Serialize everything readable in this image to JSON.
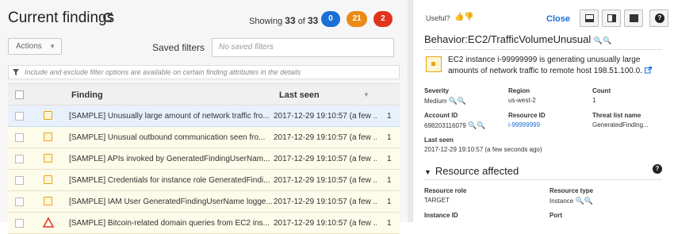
{
  "header": {
    "title": "Current findings",
    "showing_prefix": "Showing",
    "showing_count": "33",
    "showing_of": "of",
    "showing_total": "33",
    "badges": [
      {
        "value": "0",
        "color": "#1a6fd6"
      },
      {
        "value": "21",
        "color": "#ec8a16"
      },
      {
        "value": "2",
        "color": "#e0341b"
      }
    ]
  },
  "toolbar": {
    "actions_label": "Actions",
    "saved_filters_label": "Saved filters",
    "saved_filters_placeholder": "No saved filters"
  },
  "filter_bar": {
    "text": "Include and exclude filter options are available on certain finding attributes in the details"
  },
  "table": {
    "columns": {
      "finding": "Finding",
      "last_seen": "Last seen"
    },
    "rows": [
      {
        "finding": "[SAMPLE] Unusually large amount of network traffic fro...",
        "last_seen": "2017-12-29 19:10:57 (a few ...",
        "count": "1",
        "severity": "medium",
        "selected": true
      },
      {
        "finding": "[SAMPLE] Unusual outbound communication seen fro...",
        "last_seen": "2017-12-29 19:10:57 (a few ...",
        "count": "1",
        "severity": "medium",
        "selected": false
      },
      {
        "finding": "[SAMPLE] APIs invoked by GeneratedFindingUserNam...",
        "last_seen": "2017-12-29 19:10:57 (a few ...",
        "count": "1",
        "severity": "medium",
        "selected": false
      },
      {
        "finding": "[SAMPLE] Credentials for instance role GeneratedFindi...",
        "last_seen": "2017-12-29 19:10:57 (a few ...",
        "count": "1",
        "severity": "medium",
        "selected": false
      },
      {
        "finding": "[SAMPLE] IAM User GeneratedFindingUserName logge...",
        "last_seen": "2017-12-29 19:10:57 (a few ...",
        "count": "1",
        "severity": "medium",
        "selected": false
      },
      {
        "finding": "[SAMPLE] Bitcoin-related domain queries from EC2 ins...",
        "last_seen": "2017-12-29 19:10:57 (a few ...",
        "count": "1",
        "severity": "high",
        "selected": false
      }
    ]
  },
  "detail": {
    "useful_label": "Useful?",
    "close_label": "Close",
    "title": "Behavior:EC2/TrafficVolumeUnusual",
    "summary": "EC2 instance i-99999999 is generating unusually large amounts of network traffic to remote host 198.51.100.0.",
    "fields": {
      "severity": {
        "label": "Severity",
        "value": "Medium"
      },
      "region": {
        "label": "Region",
        "value": "us-west-2"
      },
      "count": {
        "label": "Count",
        "value": "1"
      },
      "account_id": {
        "label": "Account ID",
        "value": "698203116079"
      },
      "resource_id": {
        "label": "Resource ID",
        "value": "i-99999999"
      },
      "threat_list": {
        "label": "Threat list name",
        "value": "GeneratedFinding..."
      },
      "last_seen": {
        "label": "Last seen",
        "value": "2017-12-29 19:10:57 (a few seconds ago)"
      }
    },
    "resource_section": "Resource affected",
    "resource_fields": {
      "role": {
        "label": "Resource role",
        "value": "TARGET"
      },
      "type": {
        "label": "Resource type",
        "value": "Instance"
      },
      "instance_id": {
        "label": "Instance ID"
      },
      "port": {
        "label": "Port"
      }
    }
  }
}
